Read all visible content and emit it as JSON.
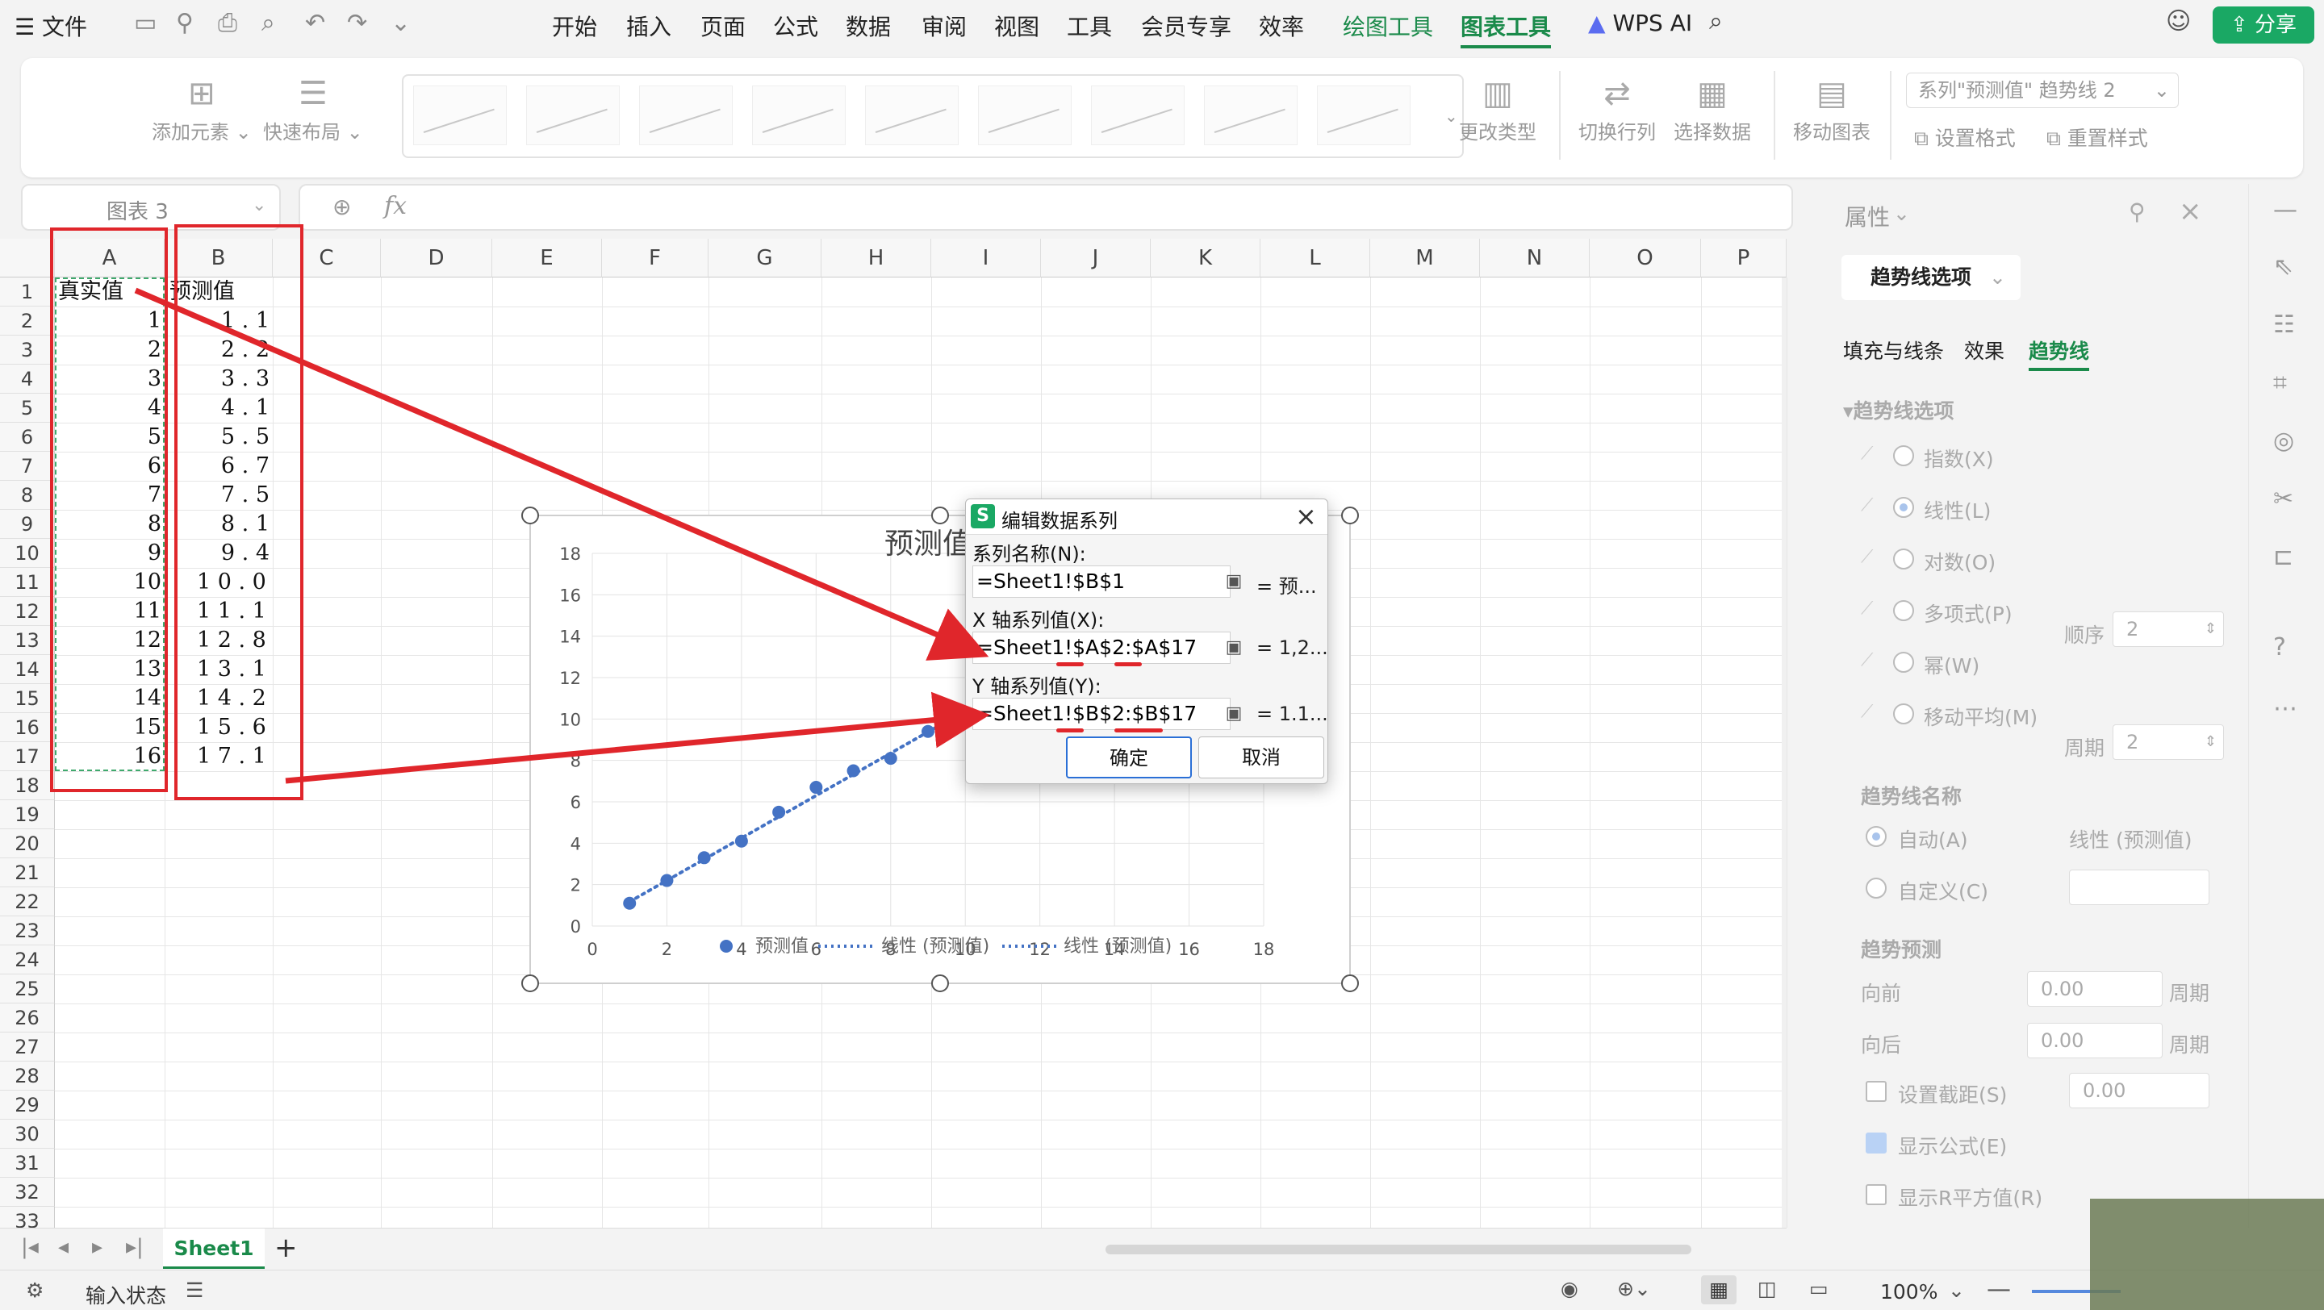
{
  "menu": {
    "file": "文件",
    "tabs": [
      "开始",
      "插入",
      "页面",
      "公式",
      "数据",
      "审阅",
      "视图",
      "工具",
      "会员专享",
      "效率",
      "绘图工具",
      "图表工具"
    ],
    "wps_ai": "WPS AI",
    "share": "分享"
  },
  "ribbon": {
    "add_element": "添加元素",
    "quick_layout": "快速布局",
    "change_type": "更改类型",
    "switch_rowcol": "切换行列",
    "select_data": "选择数据",
    "move_chart": "移动图表",
    "series_select": "系列\"预测值\" 趋势线 2",
    "set_format": "设置格式",
    "reset_style": "重置样式"
  },
  "formula": {
    "name_box": "图表 3",
    "fx": "fx"
  },
  "sheet": {
    "columns": [
      "A",
      "B",
      "C",
      "D",
      "E",
      "F",
      "G",
      "H",
      "I",
      "J",
      "K",
      "L",
      "M",
      "N",
      "O",
      "P"
    ],
    "rows": [
      "1",
      "2",
      "3",
      "4",
      "5",
      "6",
      "7",
      "8",
      "9",
      "10",
      "11",
      "12",
      "13",
      "14",
      "15",
      "16",
      "17",
      "18",
      "19",
      "20",
      "21",
      "22",
      "23",
      "24",
      "25",
      "26",
      "27",
      "28",
      "29",
      "30",
      "31",
      "32",
      "33"
    ],
    "header_a": "真实值",
    "header_b": "预测值",
    "col_a": [
      "1",
      "2",
      "3",
      "4",
      "5",
      "6",
      "7",
      "8",
      "9",
      "10",
      "11",
      "12",
      "13",
      "14",
      "15",
      "16"
    ],
    "col_b": [
      "1.1",
      "2.2",
      "3.3",
      "4.1",
      "5.5",
      "6.7",
      "7.5",
      "8.1",
      "9.4",
      "10.0",
      "11.1",
      "12.8",
      "13.1",
      "14.2",
      "15.6",
      "17.1"
    ],
    "tab": "Sheet1"
  },
  "chart_data": {
    "type": "scatter",
    "title": "预测值",
    "x": [
      1,
      2,
      3,
      4,
      5,
      6,
      7,
      8,
      9,
      10,
      11,
      12,
      13,
      14,
      15,
      16
    ],
    "y": [
      1.1,
      2.2,
      3.3,
      4.1,
      5.5,
      6.7,
      7.5,
      8.1,
      9.4,
      10.0,
      11.1,
      12.8,
      13.1,
      14.2,
      15.6,
      17.1
    ],
    "xlim": [
      0,
      18
    ],
    "ylim": [
      0,
      18
    ],
    "xticks": [
      "0",
      "2",
      "4",
      "6",
      "8",
      "10",
      "12",
      "14",
      "16",
      "18"
    ],
    "yticks": [
      "0",
      "2",
      "4",
      "6",
      "8",
      "10",
      "12",
      "14",
      "16",
      "18"
    ],
    "legend": [
      "预测值",
      "线性 (预测值)",
      "线性 (预测值)"
    ],
    "marker_color": "#4472c4",
    "grid": true
  },
  "dialog": {
    "title": "编辑数据系列",
    "name_label": "系列名称(N):",
    "name_value": "=Sheet1!$B$1",
    "name_result": "= 预...",
    "x_label": "X 轴系列值(X):",
    "x_value": "=Sheet1!$A$2:$A$17",
    "x_result": "= 1,2...",
    "y_label": "Y 轴系列值(Y):",
    "y_value": "=Sheet1!$B$2:$B$17",
    "y_result": "= 1.1...",
    "ok": "确定",
    "cancel": "取消"
  },
  "panel": {
    "title": "属性",
    "dropdown": "趋势线选项",
    "tabs": [
      "填充与线条",
      "效果",
      "趋势线"
    ],
    "section": "▾趋势线选项",
    "options": [
      "指数(X)",
      "线性(L)",
      "对数(O)",
      "多项式(P)",
      "幂(W)",
      "移动平均(M)"
    ],
    "order_label": "顺序",
    "order_value": "2",
    "period_label": "周期",
    "period_value": "2",
    "name_section": "趋势线名称",
    "auto": "自动(A)",
    "auto_value": "线性 (预测值)",
    "custom": "自定义(C)",
    "forecast_section": "趋势预测",
    "forward": "向前",
    "backward": "向后",
    "forward_value": "0.00",
    "backward_value": "0.00",
    "period_unit": "周期",
    "intercept": "设置截距(S)",
    "intercept_value": "0.00",
    "show_formula": "显示公式(E)",
    "show_r2": "显示R平方值(R)"
  },
  "status": {
    "input_state": "输入状态",
    "zoom": "100%"
  },
  "colors": {
    "accent": "#1a8a4a",
    "annotation": "#e0262b"
  }
}
